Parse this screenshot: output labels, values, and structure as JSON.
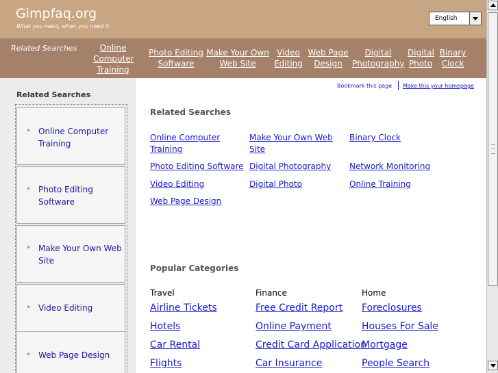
{
  "header": {
    "title": "Gimpfaq.org",
    "tagline": "What you need, when you need it",
    "language": "English"
  },
  "nav": {
    "label": "Related Searches",
    "links": [
      "Online Computer Training",
      "Photo Editing Software",
      "Make Your Own Web Site",
      "Video Editing",
      "Web Page Design",
      "Digital Photography",
      "Digital Photo",
      "Binary Clock"
    ]
  },
  "sidebar": {
    "title": "Related Searches",
    "items": [
      "Online Computer Training",
      "Photo Editing Software",
      "Make Your Own Web Site",
      "Video Editing",
      "Web Page Design"
    ]
  },
  "toplinks": {
    "bookmark": "Bookmark this page",
    "homepage": "Make this your homepage"
  },
  "related": {
    "title": "Related Searches",
    "links": [
      "Online Computer Training",
      "Make Your Own Web Site",
      "Binary Clock",
      "Photo Editing Software",
      "Digital Photography",
      "Network Monitoring",
      "Video Editing",
      "Digital Photo",
      "Online Training",
      "Web Page Design"
    ]
  },
  "popular": {
    "title": "Popular Categories",
    "columns": [
      {
        "heading": "Travel",
        "links": [
          "Airline Tickets",
          "Hotels",
          "Car Rental",
          "Flights"
        ]
      },
      {
        "heading": "Finance",
        "links": [
          "Free Credit Report",
          "Online Payment",
          "Credit Card Application",
          "Car Insurance"
        ]
      },
      {
        "heading": "Home",
        "links": [
          "Foreclosures",
          "Houses For Sale",
          "Mortgage",
          "People Search"
        ]
      }
    ]
  },
  "colors": {
    "header_bg": "#c8a583",
    "nav_bg": "#a5816a",
    "link": "#1a1acc",
    "sidebar_bg": "#ececec",
    "bullet": "#c8925a"
  }
}
